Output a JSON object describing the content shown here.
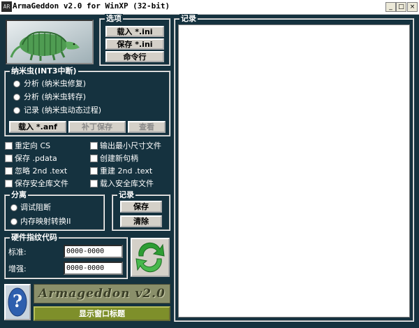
{
  "window": {
    "icon_label": "AR",
    "title": "ArmaGeddon v2.0 for WinXP (32-bit)",
    "minimize": "_",
    "maximize": "□",
    "close": "×"
  },
  "options": {
    "label": "选项",
    "load_ini": "载入 *.ini",
    "save_ini": "保存 *.ini",
    "command_line": "命令行"
  },
  "nanomites": {
    "label": "纳米虫(INT3中断)",
    "radios": [
      "分析 (纳米虫修复)",
      "分析 (纳米虫转存)",
      "记录 (纳米虫动态过程)"
    ],
    "load_anf": "载入 *.anf",
    "patch_save": "补丁保存",
    "view": "查看"
  },
  "checkboxes": {
    "left": [
      "重定向 CS",
      "保存 .pdata",
      "忽略 2nd .text",
      "保存安全库文件"
    ],
    "right": [
      "输出最小尺寸文件",
      "创建新句柄",
      "重建 2nd .text",
      "载入安全库文件"
    ]
  },
  "separate": {
    "label": "分离",
    "radios": [
      "调试阻断",
      "内存映射转换II"
    ]
  },
  "record_group": {
    "label": "记录",
    "save": "保存",
    "clear": "清除"
  },
  "hwid": {
    "label": "硬件指纹代码",
    "standard_label": "标准:",
    "standard_value": "0000-0000",
    "enhanced_label": "增强:",
    "enhanced_value": "0000-0000"
  },
  "log_panel": {
    "label": "记录"
  },
  "logo_text": "Armageddon v2.0",
  "help_icon_glyph": "?",
  "show_title_button": "显示窗口标题"
}
